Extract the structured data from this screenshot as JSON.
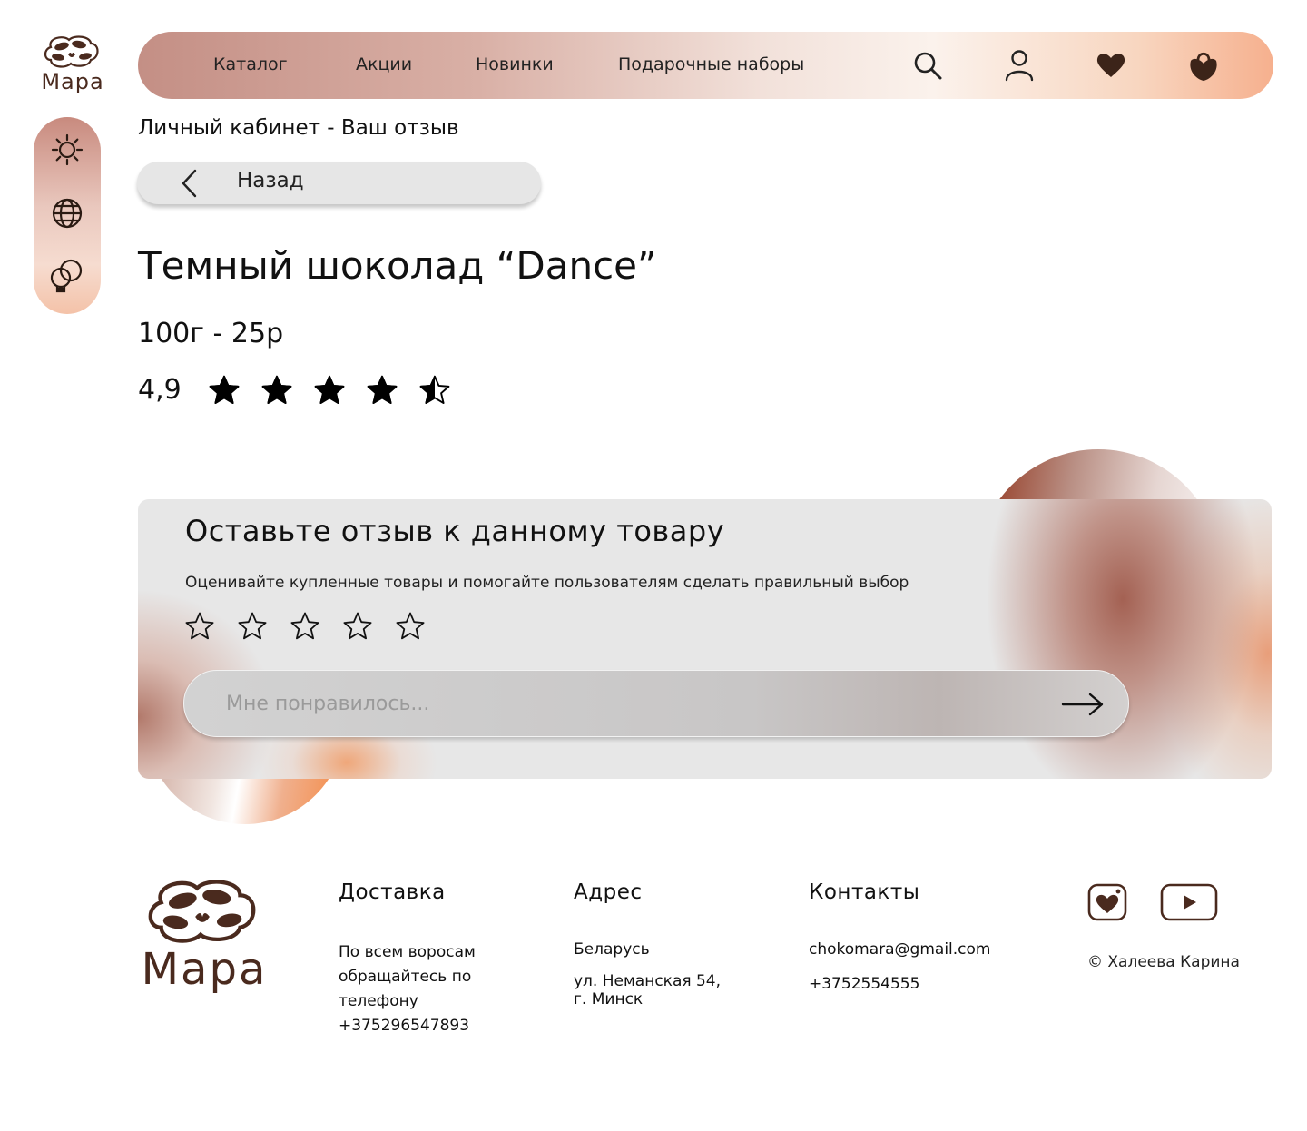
{
  "brand": {
    "name": "Мара"
  },
  "nav": {
    "items": [
      "Каталог",
      "Акции",
      "Новинки",
      "Подарочные наборы"
    ],
    "icons": [
      "search-icon",
      "user-icon",
      "heart-icon",
      "shopping-bag-icon"
    ]
  },
  "side": {
    "icons": [
      "sun-icon",
      "globe-icon",
      "lightbulb-icon"
    ]
  },
  "breadcrumb": "Личный кабинет - Ваш отзыв",
  "back": {
    "label": "Назад"
  },
  "product": {
    "title": "Темный шоколад “Dance”",
    "price": "100г - 25р",
    "rating_text": "4,9",
    "rating": 4.5,
    "rating_max": 5
  },
  "review": {
    "title": "Оставьте отзыв к данному товару",
    "subtitle": "Оценивайте купленные товары и помогайте пользователям сделать правильный выбор",
    "stars": 5,
    "placeholder": "Мне понравилось..."
  },
  "footer": {
    "delivery": {
      "title": "Доставка",
      "lines": [
        "По всем воросам",
        "обращайтесь по",
        "телефону",
        "+375296547893"
      ]
    },
    "address": {
      "title": "Адрес",
      "country": "Беларусь",
      "street": [
        "ул. Неманская 54,",
        "г. Минск"
      ]
    },
    "contacts": {
      "title": "Контакты",
      "email": "chokomara@gmail.com",
      "phone": "+3752554555"
    },
    "copyright": "© Халеева Карина"
  },
  "colors": {
    "brown": "#4a2a1e",
    "accent": "#f08a4b",
    "card": "#e7e7e7"
  }
}
